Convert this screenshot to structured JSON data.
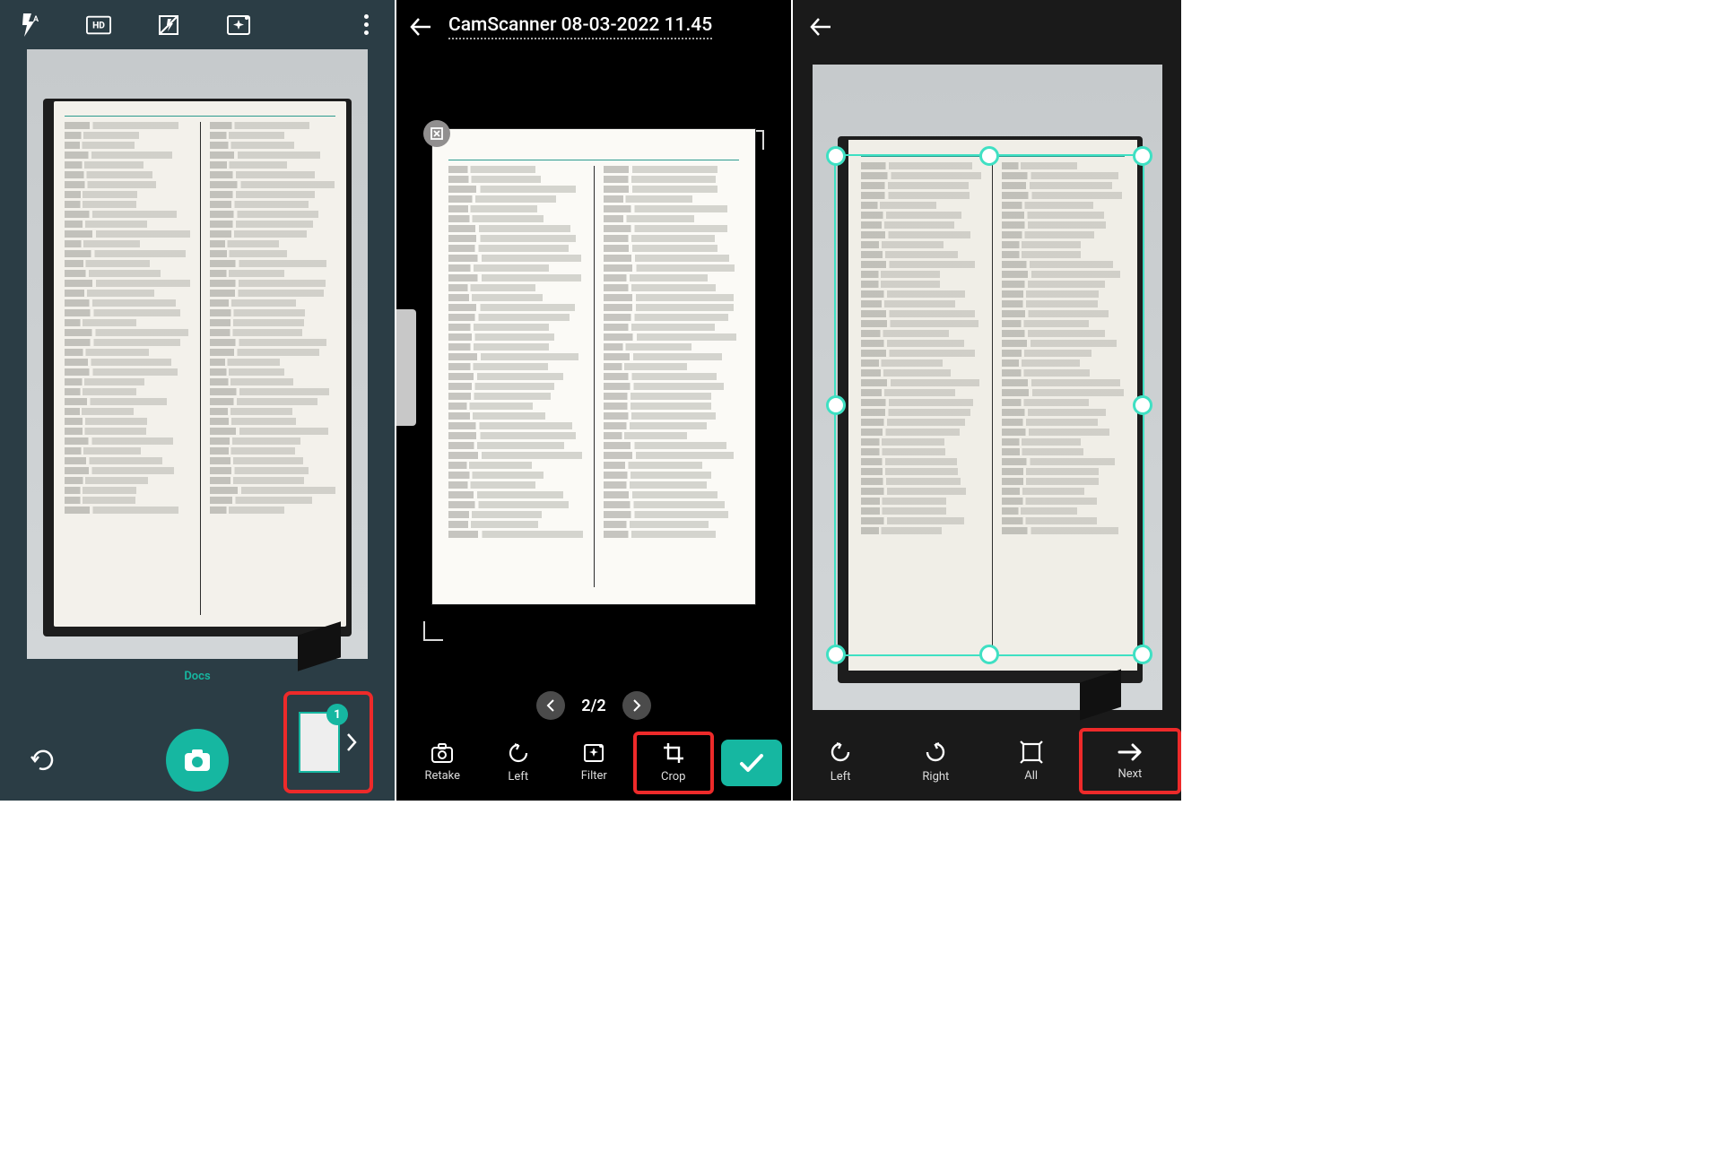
{
  "panel1": {
    "flash_mode": "A",
    "docs_tab_label": "Docs",
    "thumb_count": "1",
    "icons": {
      "flash": "flash-auto-icon",
      "hd": "hd-icon",
      "no_flash": "flash-adjust-icon",
      "sparkle": "enhance-icon",
      "more": "more-vert-icon",
      "undo": "undo-icon",
      "shutter": "camera-icon",
      "chevron": "chevron-right-icon"
    }
  },
  "panel2": {
    "document_title": "CamScanner 08-03-2022 11.45",
    "page_indicator": "2/2",
    "tools": {
      "retake": "Retake",
      "left": "Left",
      "filter": "Filter",
      "crop": "Crop"
    }
  },
  "panel3": {
    "tools": {
      "left": "Left",
      "right": "Right",
      "all": "All",
      "next": "Next"
    }
  },
  "colors": {
    "accent": "#16b7a1",
    "crop_handle": "#3fe0c3",
    "highlight": "#ee2a2a"
  }
}
